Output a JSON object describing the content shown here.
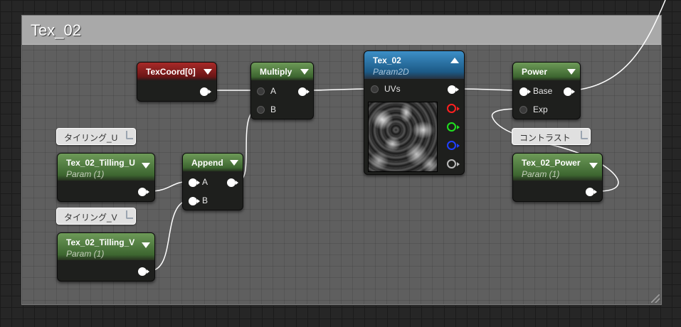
{
  "comment": {
    "title": "Tex_02"
  },
  "nodes": {
    "texcoord": {
      "title": "TexCoord[0]"
    },
    "multiply": {
      "title": "Multiply",
      "pin_a": "A",
      "pin_b": "B"
    },
    "append": {
      "title": "Append",
      "pin_a": "A",
      "pin_b": "B"
    },
    "tex02": {
      "title": "Tex_02",
      "subtitle": "Param2D",
      "pin_uvs": "UVs"
    },
    "power": {
      "title": "Power",
      "pin_base": "Base",
      "pin_exp": "Exp"
    },
    "tilling_u": {
      "title": "Tex_02_Tilling_U",
      "subtitle": "Param (1)"
    },
    "tilling_v": {
      "title": "Tex_02_Tilling_V",
      "subtitle": "Param (1)"
    },
    "tex02_power": {
      "title": "Tex_02_Power",
      "subtitle": "Param (1)"
    }
  },
  "comment_bubbles": {
    "tilling_u": "タイリング_U",
    "tilling_v": "タイリング_V",
    "power": "コントラスト"
  },
  "colors": {
    "header_red": "#8b1f1f",
    "header_green": "#4d7a3c",
    "header_blue": "#2a74a8",
    "comment_box": "#5f5f5f",
    "comment_header": "#a9a9a9",
    "wire": "#ffffff",
    "channel_r": "#ff2020",
    "channel_g": "#20e020",
    "channel_b": "#2040ff",
    "channel_a": "#bbbbbb"
  },
  "icons": [
    "collapse-arrow-icon",
    "pin-icon",
    "resize-grip-icon"
  ]
}
